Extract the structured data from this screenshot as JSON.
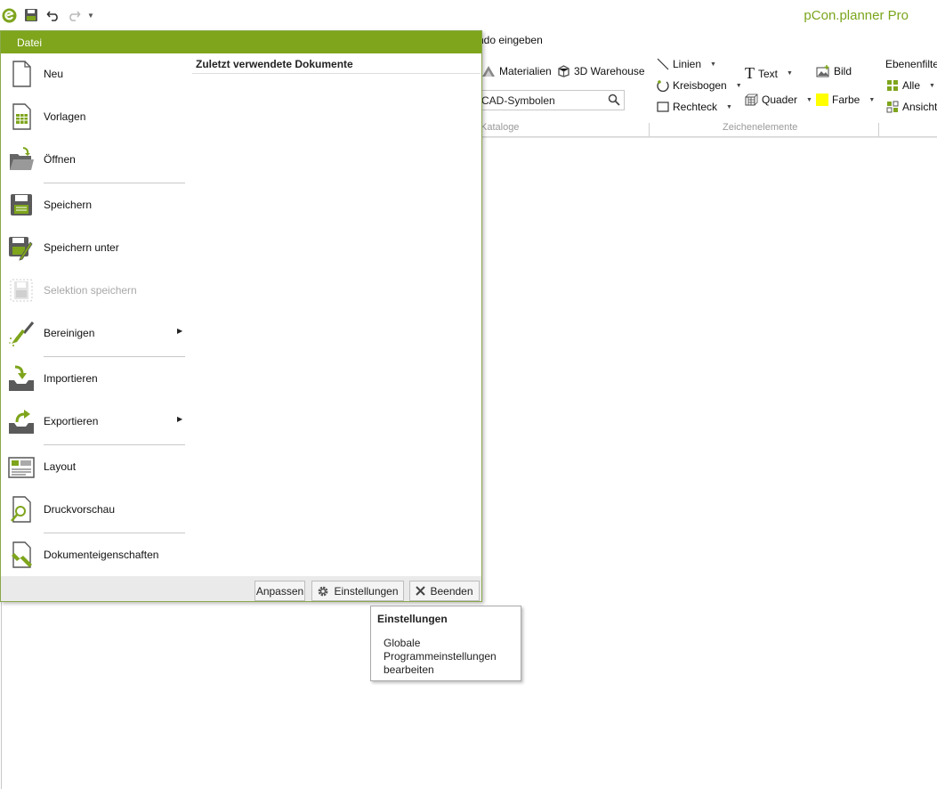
{
  "app": {
    "title": "pCon.planner Pro"
  },
  "ribbon": {
    "command_prompt": "ndo eingeben",
    "materials": "Materialien",
    "warehouse": "3D Warehouse",
    "search_value": "CAD-Symbolen",
    "groups": {
      "catalogs": "Kataloge",
      "drawing": "Zeichenelemente"
    },
    "drawing": {
      "lines": "Linien",
      "arcs": "Kreisbogen",
      "rect": "Rechteck",
      "text": "Text",
      "box": "Quader",
      "image": "Bild",
      "color": "Farbe"
    },
    "filter": {
      "title": "Ebenenfilte",
      "all": "Alle",
      "view": "Ansicht"
    },
    "accent": "#7ea51c",
    "color_swatch": "#ffff00"
  },
  "file_menu": {
    "tab_label": "Datei",
    "items": [
      {
        "label": "Neu"
      },
      {
        "label": "Vorlagen"
      },
      {
        "label": "Öffnen"
      },
      {
        "label": "Speichern"
      },
      {
        "label": "Speichern unter"
      },
      {
        "label": "Selektion speichern"
      },
      {
        "label": "Bereinigen"
      },
      {
        "label": "Importieren"
      },
      {
        "label": "Exportieren"
      },
      {
        "label": "Layout"
      },
      {
        "label": "Druckvorschau"
      },
      {
        "label": "Dokumenteigenschaften"
      }
    ],
    "recent_title": "Zuletzt verwendete Dokumente",
    "footer": {
      "customize": "Anpassen",
      "settings": "Einstellungen",
      "exit": "Beenden"
    }
  },
  "tooltip": {
    "title": "Einstellungen",
    "body": "Globale Programmeinstellungen bearbeiten"
  }
}
